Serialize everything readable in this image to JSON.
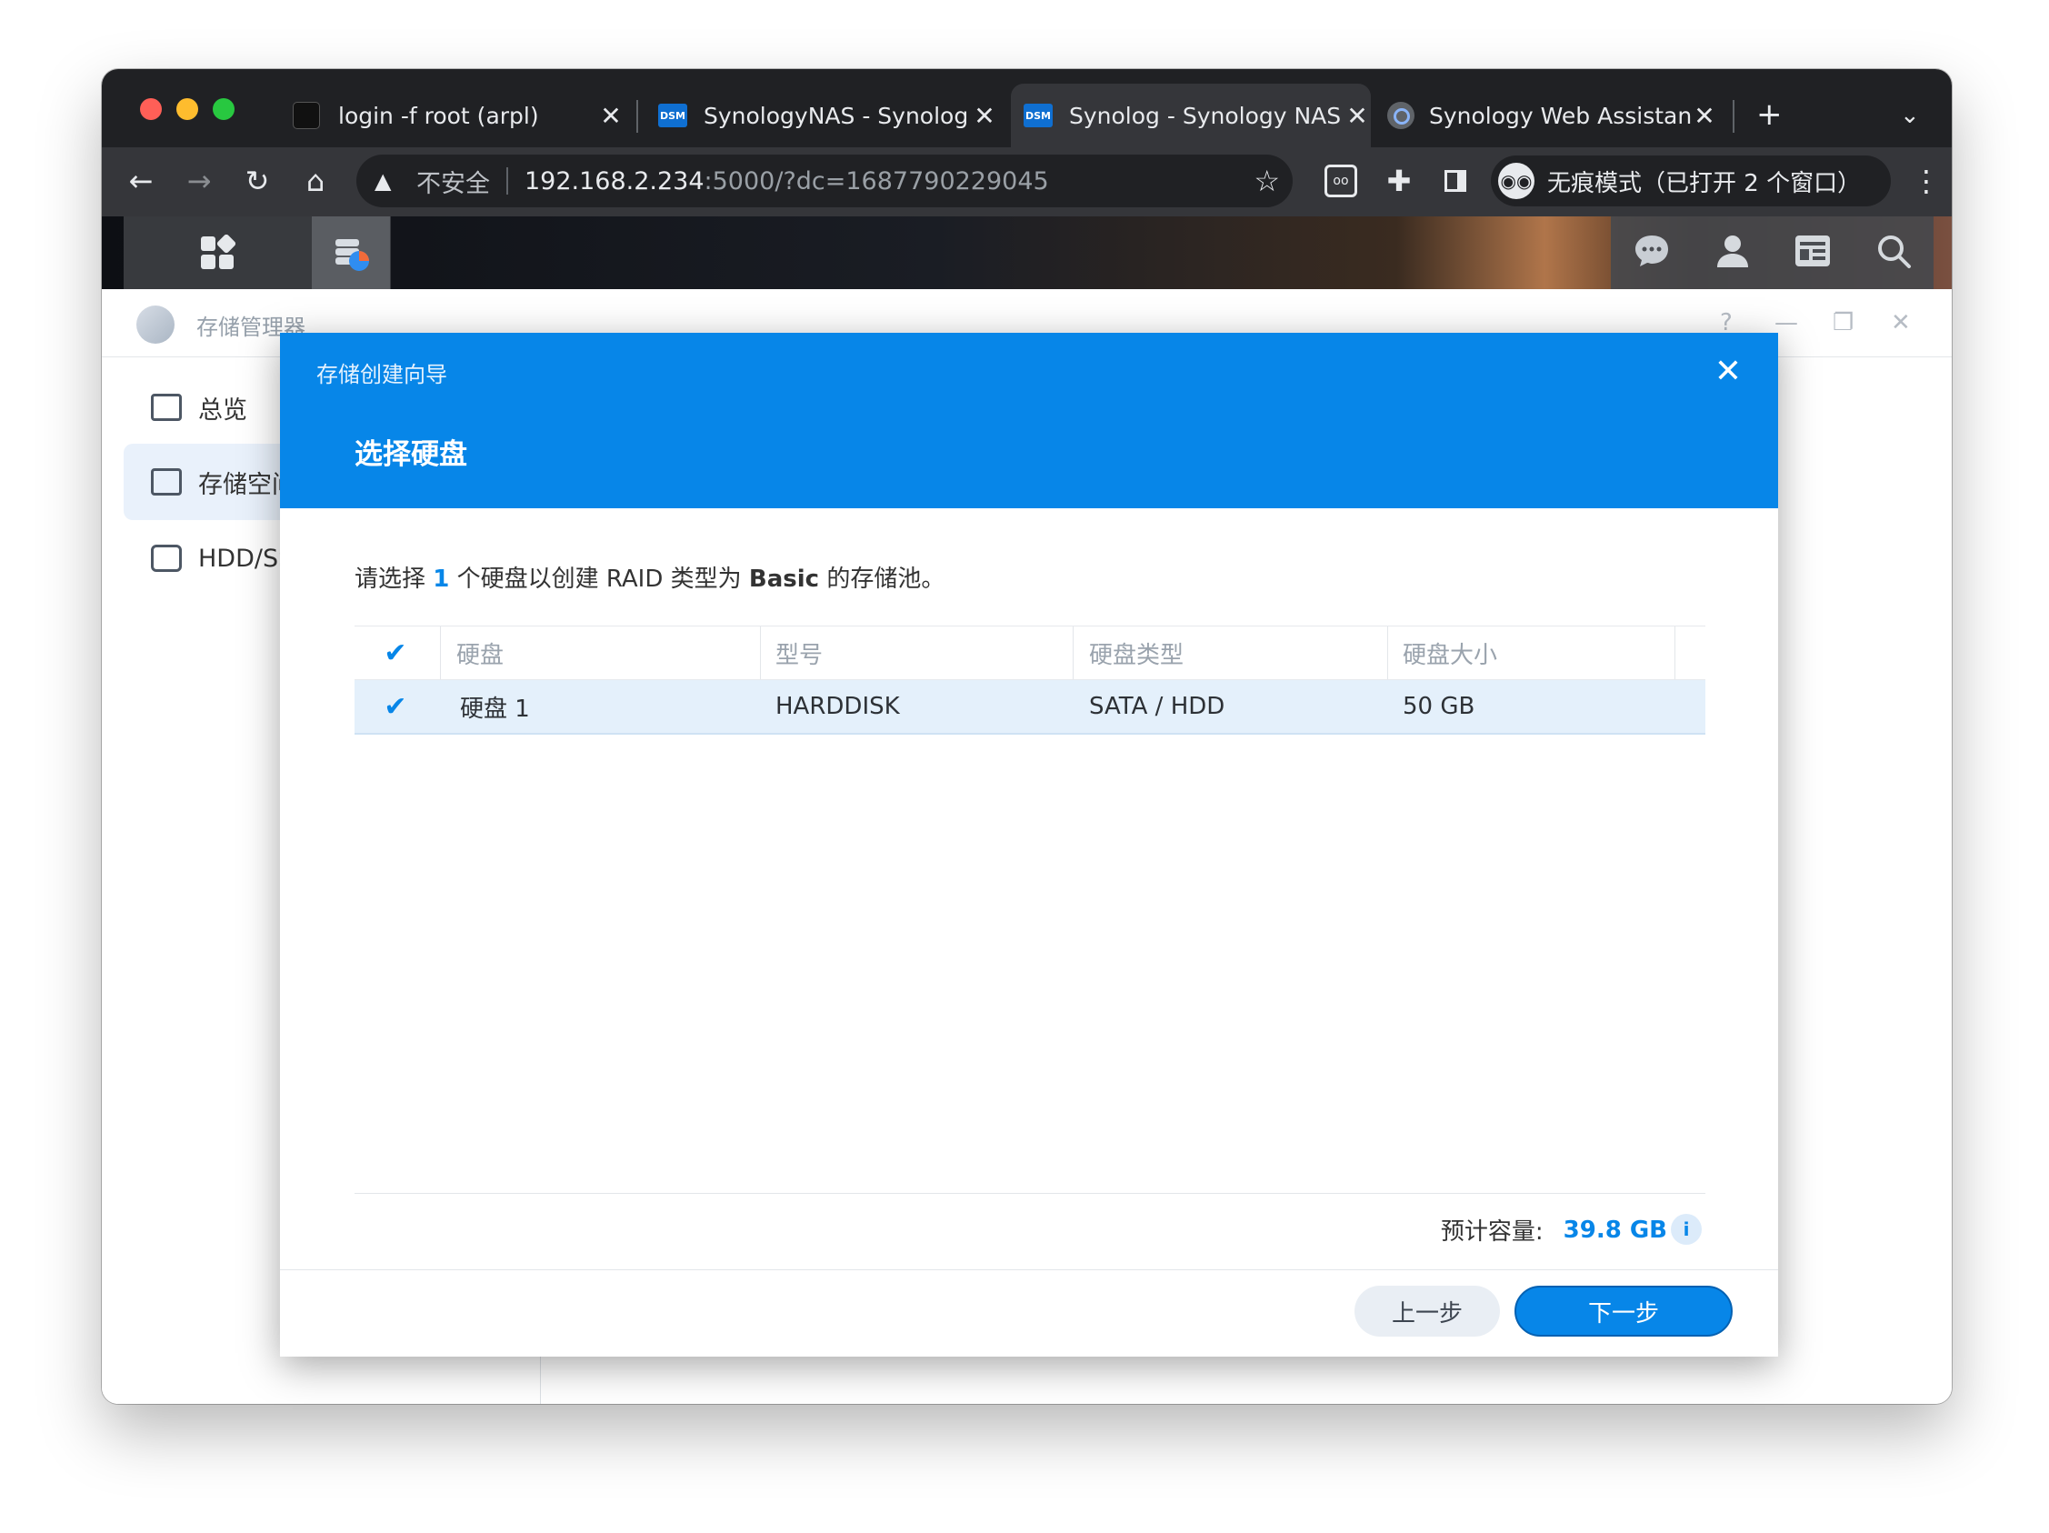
{
  "browser": {
    "tabs": [
      {
        "title": "login -f root (arpl)",
        "favicon": "terminal-icon",
        "active": false
      },
      {
        "title": "SynologyNAS - Synolog",
        "favicon": "dsm-icon",
        "active": false
      },
      {
        "title": "Synolog - Synology NAS",
        "favicon": "dsm-icon",
        "active": true
      },
      {
        "title": "Synology Web Assistant",
        "favicon": "web-assistant-icon",
        "active": false
      }
    ],
    "dsm_favicon_text": "DSM",
    "security_label": "不安全",
    "url_host": "192.168.2.234",
    "url_path": ":5000/?dc=1687790229045",
    "incognito_label": "无痕模式（已打开 2 个窗口）"
  },
  "app": {
    "title": "存储管理器",
    "sidebar": [
      {
        "label": "总览",
        "active": false
      },
      {
        "label": "存储空间",
        "active": true
      },
      {
        "label": "HDD/SSD",
        "active": false
      }
    ]
  },
  "wizard": {
    "title": "存储创建向导",
    "step_title": "选择硬盘",
    "instruction_pre": "请选择 ",
    "instruction_count": "1",
    "instruction_mid": " 个硬盘以创建 RAID 类型为 ",
    "instruction_type": "Basic",
    "instruction_post": " 的存储池。",
    "table": {
      "columns": [
        "硬盘",
        "型号",
        "硬盘类型",
        "硬盘大小"
      ],
      "rows": [
        {
          "selected": true,
          "disk": "硬盘 1",
          "model": "HARDDISK",
          "type": "SATA / HDD",
          "size": "50 GB"
        }
      ]
    },
    "estimated_capacity_label": "预计容量:",
    "estimated_capacity_value": "39.8 GB",
    "buttons": {
      "prev": "上一步",
      "next": "下一步"
    }
  },
  "colors": {
    "accent": "#0786e8",
    "chrome_dark": "#202124",
    "chrome_toolbar": "#35363a"
  }
}
